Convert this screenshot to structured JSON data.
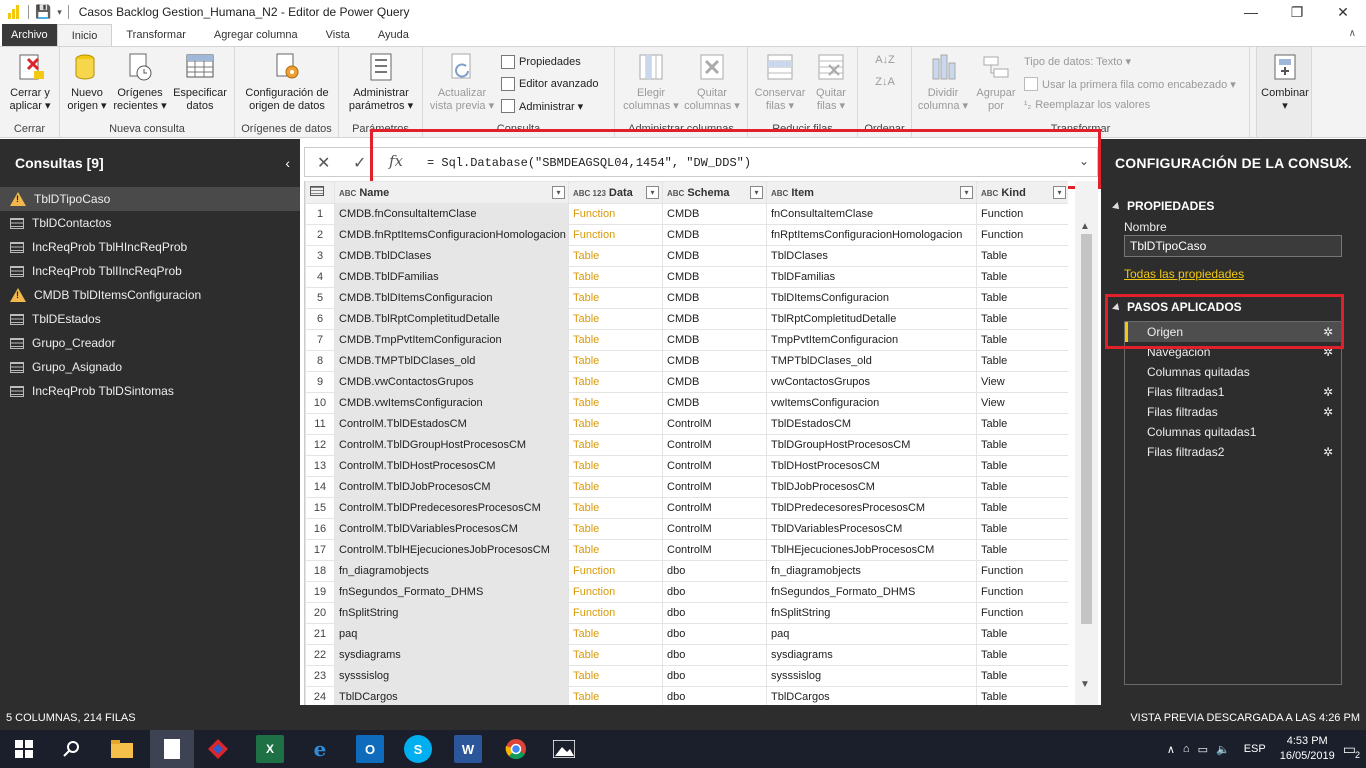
{
  "window": {
    "title": "Casos Backlog Gestion_Humana_N2 - Editor de Power Query"
  },
  "menu_tabs": [
    "Archivo",
    "Inicio",
    "Transformar",
    "Agregar columna",
    "Vista",
    "Ayuda"
  ],
  "ribbon": {
    "groups": {
      "cerrar": "Cerrar",
      "nueva_consulta": "Nueva consulta",
      "origenes": "Orígenes de datos",
      "parametros": "Parámetros",
      "consulta": "Consulta",
      "admin_columnas": "Administrar columnas",
      "reducir_filas": "Reducir filas",
      "ordenar": "Ordenar",
      "transformar": "Transformar"
    },
    "cerrar_aplicar": [
      "Cerrar y",
      "aplicar ▾"
    ],
    "nuevo_origen": [
      "Nuevo",
      "origen ▾"
    ],
    "origenes_recientes": [
      "Orígenes",
      "recientes ▾"
    ],
    "especificar_datos": [
      "Especificar",
      "datos"
    ],
    "config_origen": [
      "Configuración de",
      "origen de datos"
    ],
    "admin_parametros": [
      "Administrar",
      "parámetros ▾"
    ],
    "actualizar_vista": [
      "Actualizar",
      "vista previa ▾"
    ],
    "propiedades": "Propiedades",
    "editor_avanzado": "Editor avanzado",
    "administrar": "Administrar ▾",
    "elegir_columnas": [
      "Elegir",
      "columnas ▾"
    ],
    "quitar_columnas": [
      "Quitar",
      "columnas ▾"
    ],
    "conservar_filas": [
      "Conservar",
      "filas ▾"
    ],
    "quitar_filas": [
      "Quitar",
      "filas ▾"
    ],
    "dividir_columna": [
      "Dividir",
      "columna ▾"
    ],
    "agrupar_por": [
      "Agrupar",
      "por"
    ],
    "tipo_datos": "Tipo de datos: Texto ▾",
    "primera_fila": "Usar la primera fila como encabezado ▾",
    "reemplazar": "Reemplazar los valores",
    "combinar": [
      "Combinar",
      "▾"
    ]
  },
  "queries": {
    "header": "Consultas [9]",
    "items": [
      {
        "label": "TblDTipoCaso",
        "icon": "warning-icon",
        "selected": true
      },
      {
        "label": "TblDContactos",
        "icon": "table-icon"
      },
      {
        "label": "IncReqProb TblHIncReqProb",
        "icon": "table-icon"
      },
      {
        "label": "IncReqProb TblIIncReqProb",
        "icon": "table-icon"
      },
      {
        "label": "CMDB TblDItemsConfiguracion",
        "icon": "warning-icon"
      },
      {
        "label": "TblDEstados",
        "icon": "table-icon"
      },
      {
        "label": "Grupo_Creador",
        "icon": "table-icon"
      },
      {
        "label": "Grupo_Asignado",
        "icon": "table-icon"
      },
      {
        "label": "IncReqProb TblDSintomas",
        "icon": "table-icon"
      }
    ]
  },
  "formula": {
    "text": "= Sql.Database(\"SBMDEAGSQL04,1454\", \"DW_DDS\")",
    "fx": "fx"
  },
  "grid": {
    "columns": [
      {
        "type": "ABC",
        "label": "Name"
      },
      {
        "type": "ABC 123",
        "label": "Data"
      },
      {
        "type": "ABC",
        "label": "Schema"
      },
      {
        "type": "ABC",
        "label": "Item"
      },
      {
        "type": "ABC",
        "label": "Kind"
      }
    ],
    "rows": [
      [
        "1",
        "CMDB.fnConsultaItemClase",
        "Function",
        "CMDB",
        "fnConsultaItemClase",
        "Function"
      ],
      [
        "2",
        "CMDB.fnRptItemsConfiguracionHomologacion",
        "Function",
        "CMDB",
        "fnRptItemsConfiguracionHomologacion",
        "Function"
      ],
      [
        "3",
        "CMDB.TblDClases",
        "Table",
        "CMDB",
        "TblDClases",
        "Table"
      ],
      [
        "4",
        "CMDB.TblDFamilias",
        "Table",
        "CMDB",
        "TblDFamilias",
        "Table"
      ],
      [
        "5",
        "CMDB.TblDItemsConfiguracion",
        "Table",
        "CMDB",
        "TblDItemsConfiguracion",
        "Table"
      ],
      [
        "6",
        "CMDB.TblRptCompletitudDetalle",
        "Table",
        "CMDB",
        "TblRptCompletitudDetalle",
        "Table"
      ],
      [
        "7",
        "CMDB.TmpPvtItemConfiguracion",
        "Table",
        "CMDB",
        "TmpPvtItemConfiguracion",
        "Table"
      ],
      [
        "8",
        "CMDB.TMPTblDClases_old",
        "Table",
        "CMDB",
        "TMPTblDClases_old",
        "Table"
      ],
      [
        "9",
        "CMDB.vwContactosGrupos",
        "Table",
        "CMDB",
        "vwContactosGrupos",
        "View"
      ],
      [
        "10",
        "CMDB.vwItemsConfiguracion",
        "Table",
        "CMDB",
        "vwItemsConfiguracion",
        "View"
      ],
      [
        "11",
        "ControlM.TblDEstadosCM",
        "Table",
        "ControlM",
        "TblDEstadosCM",
        "Table"
      ],
      [
        "12",
        "ControlM.TblDGroupHostProcesosCM",
        "Table",
        "ControlM",
        "TblDGroupHostProcesosCM",
        "Table"
      ],
      [
        "13",
        "ControlM.TblDHostProcesosCM",
        "Table",
        "ControlM",
        "TblDHostProcesosCM",
        "Table"
      ],
      [
        "14",
        "ControlM.TblDJobProcesosCM",
        "Table",
        "ControlM",
        "TblDJobProcesosCM",
        "Table"
      ],
      [
        "15",
        "ControlM.TblDPredecesoresProcesosCM",
        "Table",
        "ControlM",
        "TblDPredecesoresProcesosCM",
        "Table"
      ],
      [
        "16",
        "ControlM.TblDVariablesProcesosCM",
        "Table",
        "ControlM",
        "TblDVariablesProcesosCM",
        "Table"
      ],
      [
        "17",
        "ControlM.TblHEjecucionesJobProcesosCM",
        "Table",
        "ControlM",
        "TblHEjecucionesJobProcesosCM",
        "Table"
      ],
      [
        "18",
        "fn_diagramobjects",
        "Function",
        "dbo",
        "fn_diagramobjects",
        "Function"
      ],
      [
        "19",
        "fnSegundos_Formato_DHMS",
        "Function",
        "dbo",
        "fnSegundos_Formato_DHMS",
        "Function"
      ],
      [
        "20",
        "fnSplitString",
        "Function",
        "dbo",
        "fnSplitString",
        "Function"
      ],
      [
        "21",
        "paq",
        "Table",
        "dbo",
        "paq",
        "Table"
      ],
      [
        "22",
        "sysdiagrams",
        "Table",
        "dbo",
        "sysdiagrams",
        "Table"
      ],
      [
        "23",
        "sysssislog",
        "Table",
        "dbo",
        "sysssislog",
        "Table"
      ],
      [
        "24",
        "TblDCargos",
        "Table",
        "dbo",
        "TblDCargos",
        "Table"
      ]
    ]
  },
  "settings": {
    "header": "CONFIGURACIÓN DE LA CONSU...",
    "propiedades": "PROPIEDADES",
    "nombre_label": "Nombre",
    "nombre_value": "TblDTipoCaso",
    "todas_propiedades": "Todas las propiedades",
    "pasos_header": "PASOS APLICADOS",
    "steps": [
      {
        "label": "Origen",
        "gear": true,
        "selected": true
      },
      {
        "label": "Navegación",
        "gear": true
      },
      {
        "label": "Columnas quitadas",
        "gear": false
      },
      {
        "label": "Filas filtradas1",
        "gear": true
      },
      {
        "label": "Filas filtradas",
        "gear": true
      },
      {
        "label": "Columnas quitadas1",
        "gear": false
      },
      {
        "label": "Filas filtradas2",
        "gear": true
      }
    ]
  },
  "status": {
    "left": "5 COLUMNAS, 214 FILAS",
    "right": "VISTA PREVIA DESCARGADA A LAS 4:26 PM"
  },
  "taskbar": {
    "lang": "ESP",
    "time": "4:53 PM",
    "date": "16/05/2019",
    "notifications": "2"
  },
  "colors": {
    "accent_yellow": "#f2c811",
    "highlight_red": "#e0202a",
    "function_text": "#d99a0b"
  }
}
